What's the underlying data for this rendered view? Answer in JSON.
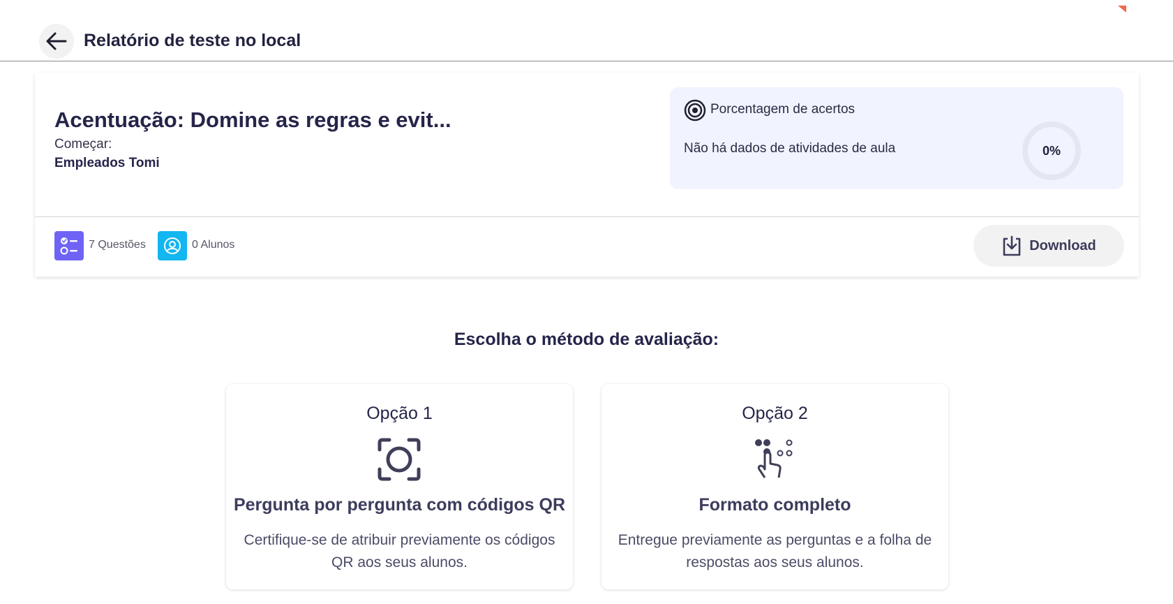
{
  "header": {
    "title": "Relatório de teste no local",
    "back_icon": "arrow-left-icon"
  },
  "summary": {
    "quiz_title": "Acentuação: Domine as regras e evit...",
    "start_label": "Começar:",
    "group_name": "Empleados Tomi",
    "accuracy": {
      "title": "Porcentagem de acertos",
      "no_data": "Não há dados de atividades de aula",
      "value": "0%",
      "icon": "target-icon"
    },
    "questions_label": "7 Questões",
    "students_label": "0 Alunos",
    "download_label": "Download"
  },
  "method": {
    "heading": "Escolha o método de avaliação:",
    "options": [
      {
        "label": "Opção 1",
        "icon": "qr-scan-icon",
        "title": "Pergunta por pergunta com códigos QR",
        "description": "Certifique-se de atribuir previamente os códigos QR aos seus alunos."
      },
      {
        "label": "Opção 2",
        "icon": "hand-tap-icon",
        "title": "Formato completo",
        "description": "Entregue previamente as perguntas e a folha de respostas aos seus alunos."
      }
    ]
  },
  "colors": {
    "questions_badge": "#6f63f5",
    "students_badge": "#12b6f0",
    "panel_bg": "#f1f3fe",
    "accent_corner": "#ef6b4a"
  }
}
